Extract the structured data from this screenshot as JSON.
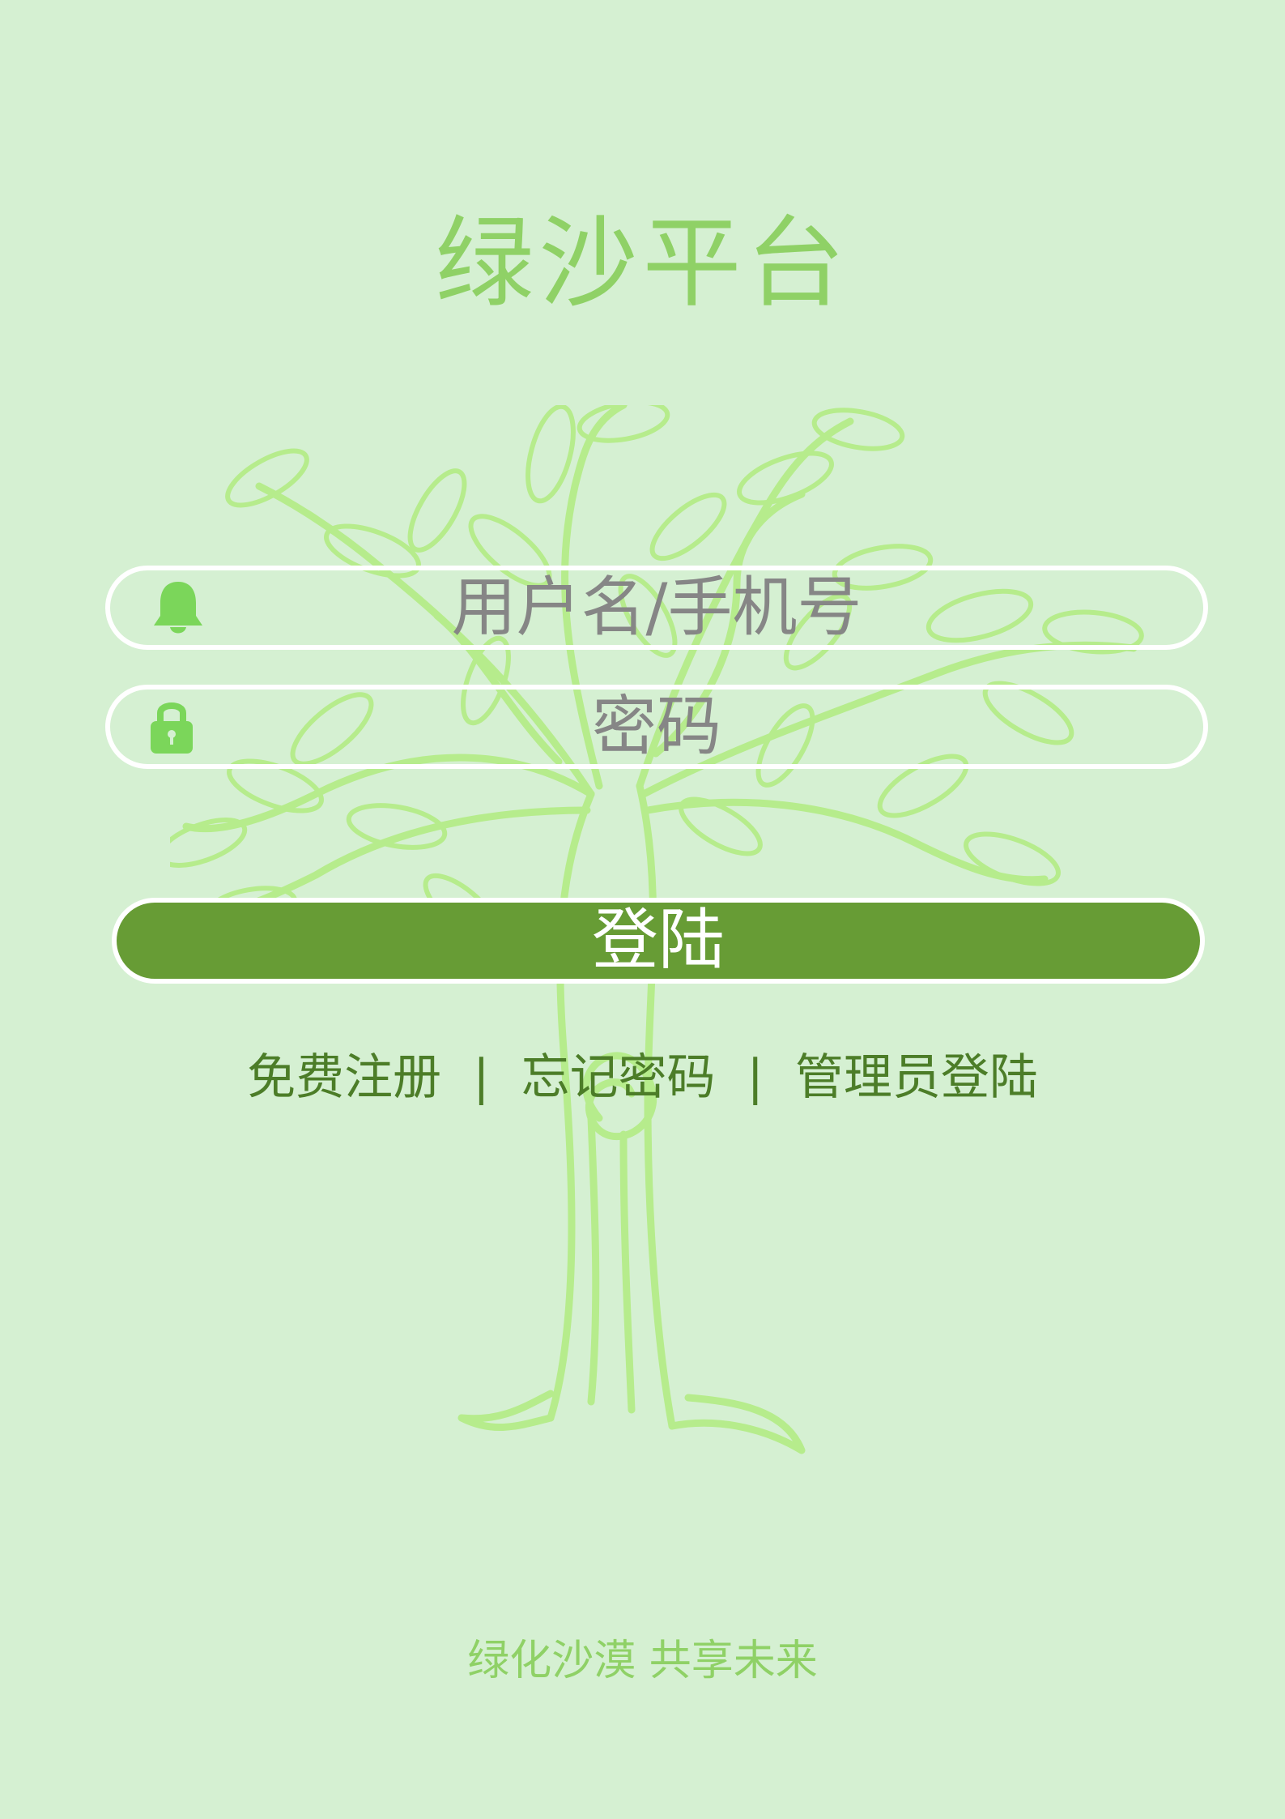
{
  "header": {
    "title": "绿沙平台"
  },
  "form": {
    "username_placeholder": "用户名/手机号",
    "password_placeholder": "密码",
    "username_icon": "bell-icon",
    "password_icon": "lock-icon",
    "login_label": "登陆"
  },
  "links": {
    "register": "免费注册",
    "forgot_password": "忘记密码",
    "admin_login": "管理员登陆",
    "separator": "|"
  },
  "footer": {
    "slogan": "绿化沙漠 共享未来"
  },
  "colors": {
    "background": "#d5f0d2",
    "title": "#8fd166",
    "tree": "#b6ec8c",
    "icon": "#7bd65a",
    "button": "#679c35",
    "links": "#4c7d28",
    "placeholder": "#868686"
  }
}
